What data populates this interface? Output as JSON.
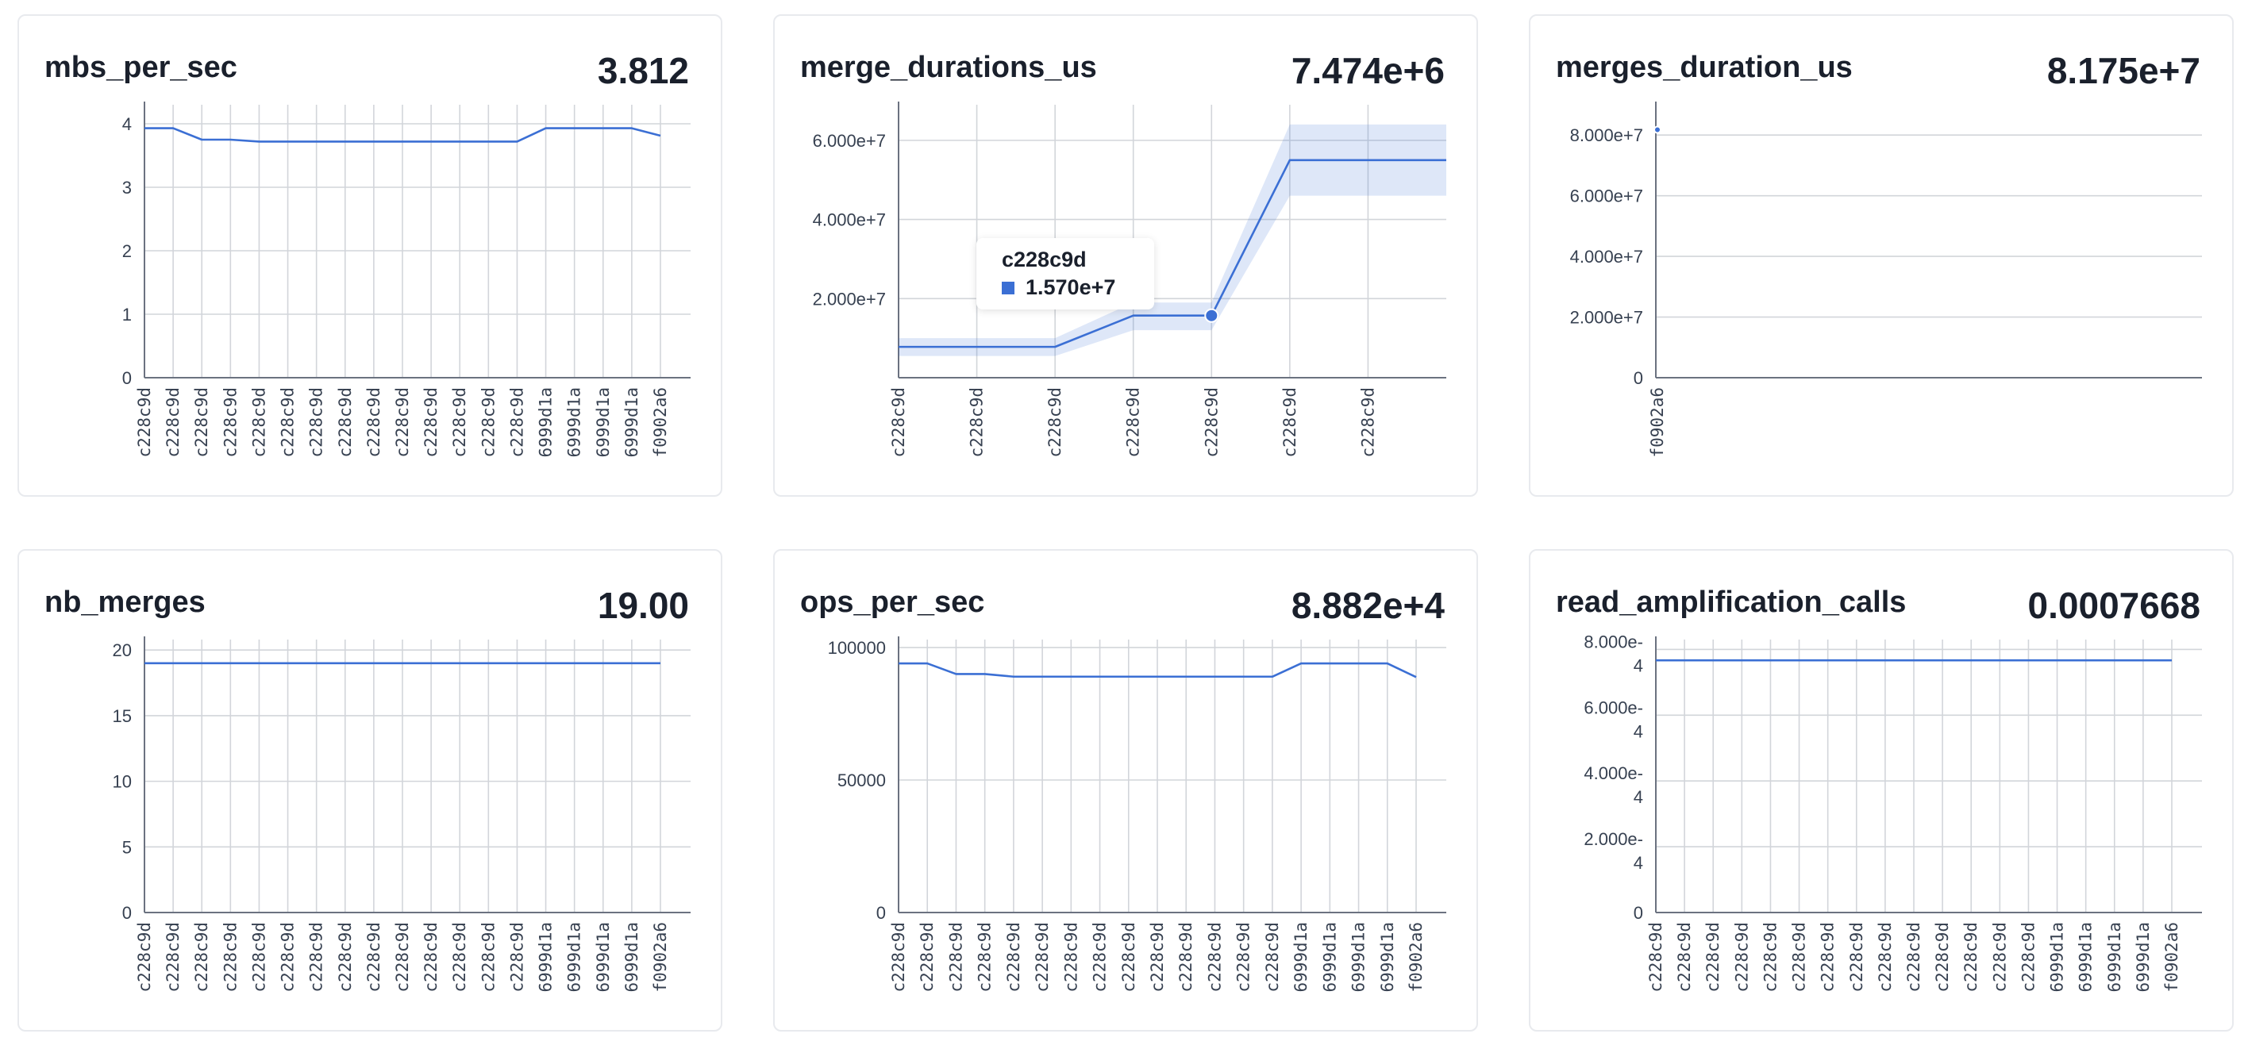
{
  "colors": {
    "line": "#3b6fd4",
    "grid": "#d2d5da",
    "text": "#1a202c"
  },
  "charts": [
    {
      "title": "mbs_per_sec",
      "value": "3.812",
      "chart_data": {
        "type": "line",
        "categories": [
          "c228c9d",
          "c228c9d",
          "c228c9d",
          "c228c9d",
          "c228c9d",
          "c228c9d",
          "c228c9d",
          "c228c9d",
          "c228c9d",
          "c228c9d",
          "c228c9d",
          "c228c9d",
          "c228c9d",
          "c228c9d",
          "6999d1a",
          "6999d1a",
          "6999d1a",
          "6999d1a",
          "f0902a6"
        ],
        "values": [
          3.93,
          3.93,
          3.75,
          3.75,
          3.72,
          3.72,
          3.72,
          3.72,
          3.72,
          3.72,
          3.72,
          3.72,
          3.72,
          3.72,
          3.93,
          3.93,
          3.93,
          3.93,
          3.812
        ],
        "yticks": [
          0,
          1,
          2,
          3,
          4
        ],
        "ytick_labels": [
          "0",
          "1",
          "2",
          "3",
          "4"
        ],
        "ylim": [
          0,
          4.3
        ],
        "grid": true
      }
    },
    {
      "title": "merge_durations_us",
      "value": "7.474e+6",
      "chart_data": {
        "type": "line",
        "categories": [
          "c228c9d",
          "c228c9d",
          "c228c9d",
          "c228c9d",
          "c228c9d",
          "c228c9d",
          "c228c9d"
        ],
        "values": [
          7800000.0,
          7800000.0,
          7800000.0,
          15700000.0,
          15700000.0,
          55000000.0,
          55000000.0
        ],
        "band_low": [
          5500000.0,
          5500000.0,
          5500000.0,
          12000000.0,
          12000000.0,
          46000000.0,
          46000000.0
        ],
        "band_high": [
          10000000.0,
          10000000.0,
          10000000.0,
          19000000.0,
          19000000.0,
          64000000.0,
          64000000.0
        ],
        "yticks": [
          20000000.0,
          40000000.0,
          60000000.0
        ],
        "ytick_labels": [
          "2.000e+7",
          "4.000e+7",
          "6.000e+7"
        ],
        "ylim": [
          0,
          69000000.0
        ],
        "grid": true,
        "highlight_index": 4,
        "tooltip": {
          "title": "c228c9d",
          "value": "1.570e+7"
        }
      }
    },
    {
      "title": "merges_duration_us",
      "value": "8.175e+7",
      "chart_data": {
        "type": "line",
        "categories": [
          "f0902a6"
        ],
        "values": [
          81750000.0
        ],
        "yticks": [
          0,
          20000000.0,
          40000000.0,
          60000000.0,
          80000000.0
        ],
        "ytick_labels": [
          "0",
          "2.000e+7",
          "4.000e+7",
          "6.000e+7",
          "8.000e+7"
        ],
        "ylim": [
          0,
          90000000.0
        ],
        "grid": true,
        "single_point": true
      }
    },
    {
      "title": "nb_merges",
      "value": "19.00",
      "chart_data": {
        "type": "line",
        "categories": [
          "c228c9d",
          "c228c9d",
          "c228c9d",
          "c228c9d",
          "c228c9d",
          "c228c9d",
          "c228c9d",
          "c228c9d",
          "c228c9d",
          "c228c9d",
          "c228c9d",
          "c228c9d",
          "c228c9d",
          "c228c9d",
          "6999d1a",
          "6999d1a",
          "6999d1a",
          "6999d1a",
          "f0902a6"
        ],
        "values": [
          19,
          19,
          19,
          19,
          19,
          19,
          19,
          19,
          19,
          19,
          19,
          19,
          19,
          19,
          19,
          19,
          19,
          19,
          19
        ],
        "yticks": [
          0,
          5,
          10,
          15,
          20
        ],
        "ytick_labels": [
          "0",
          "5",
          "10",
          "15",
          "20"
        ],
        "ylim": [
          0,
          20.8
        ],
        "grid": true
      }
    },
    {
      "title": "ops_per_sec",
      "value": "8.882e+4",
      "chart_data": {
        "type": "line",
        "categories": [
          "c228c9d",
          "c228c9d",
          "c228c9d",
          "c228c9d",
          "c228c9d",
          "c228c9d",
          "c228c9d",
          "c228c9d",
          "c228c9d",
          "c228c9d",
          "c228c9d",
          "c228c9d",
          "c228c9d",
          "c228c9d",
          "6999d1a",
          "6999d1a",
          "6999d1a",
          "6999d1a",
          "f0902a6"
        ],
        "values": [
          94000,
          94000,
          90000,
          90000,
          89000,
          89000,
          89000,
          89000,
          89000,
          89000,
          89000,
          89000,
          89000,
          89000,
          94000,
          94000,
          94000,
          94000,
          88820
        ],
        "yticks": [
          0,
          50000,
          100000
        ],
        "ytick_labels": [
          "0",
          "50000",
          "100000"
        ],
        "ylim": [
          0,
          103000
        ],
        "grid": true
      }
    },
    {
      "title": "read_amplification_calls",
      "value": "0.0007668",
      "chart_data": {
        "type": "line",
        "categories": [
          "c228c9d",
          "c228c9d",
          "c228c9d",
          "c228c9d",
          "c228c9d",
          "c228c9d",
          "c228c9d",
          "c228c9d",
          "c228c9d",
          "c228c9d",
          "c228c9d",
          "c228c9d",
          "c228c9d",
          "c228c9d",
          "6999d1a",
          "6999d1a",
          "6999d1a",
          "6999d1a",
          "f0902a6"
        ],
        "values": [
          0.0007668,
          0.0007668,
          0.0007668,
          0.0007668,
          0.0007668,
          0.0007668,
          0.0007668,
          0.0007668,
          0.0007668,
          0.0007668,
          0.0007668,
          0.0007668,
          0.0007668,
          0.0007668,
          0.0007668,
          0.0007668,
          0.0007668,
          0.0007668,
          0.0007668
        ],
        "yticks": [
          0,
          0.0002,
          0.0004,
          0.0006,
          0.0008
        ],
        "ytick_labels": [
          "0",
          "2.000e-4",
          "4.000e-4",
          "6.000e-4",
          "8.000e-4"
        ],
        "ylim": [
          0,
          0.00083
        ],
        "grid": true
      }
    }
  ]
}
